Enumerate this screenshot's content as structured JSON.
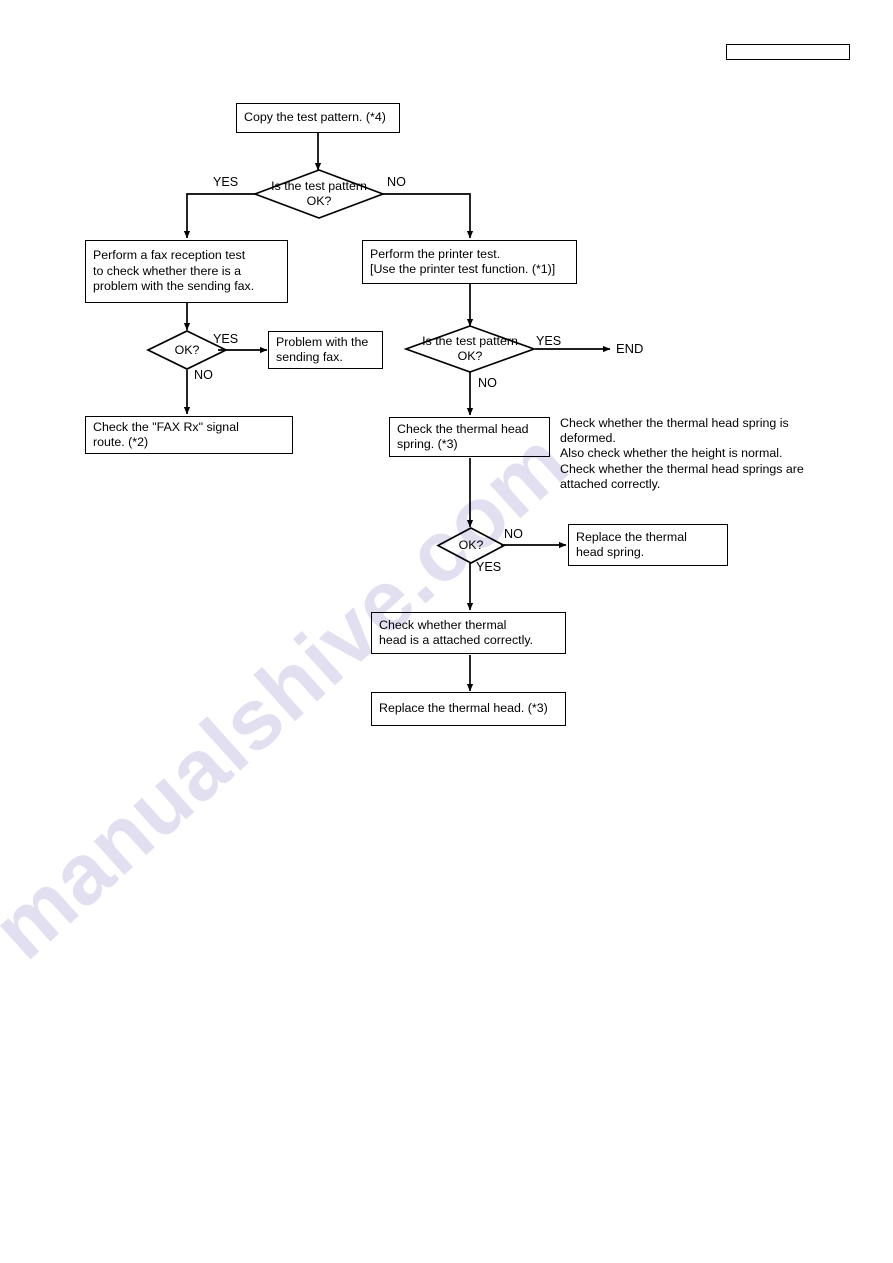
{
  "page": {
    "title": "Test pattern / thermal head troubleshooting flowchart",
    "background_color": "#ffffff",
    "line_color": "#000000"
  },
  "watermark": {
    "text": "manualshive.com",
    "color": "#4b3fa8"
  },
  "header": {
    "empty_box_label": ""
  },
  "nodes": {
    "copy_test_pattern": "Copy the test pattern. (*4)",
    "is_test_pattern_ok_1": "Is the test pattern\nOK?",
    "fax_reception_test": "Perform a fax reception test\nto check whether there is a\nproblem with the sending fax.",
    "printer_test": "Perform the printer test.\n[Use the printer test function. (*1)]",
    "ok_left": "OK?",
    "problem_sending_fax": "Problem with the\nsending fax.",
    "check_fax_rx_route": "Check the \"FAX Rx\" signal\nroute. (*2)",
    "is_test_pattern_ok_2": "Is the test pattern\nOK?",
    "end": "END",
    "check_thermal_head_spring": "Check the thermal head\nspring. (*3)",
    "spring_note": "Check whether the thermal head spring is\ndeformed.\nAlso check whether the height is normal.\nCheck whether the thermal head springs are\nattached correctly.",
    "ok_spring": "OK?",
    "replace_thermal_head_spring": "Replace the thermal\nhead spring.",
    "check_thermal_head_attached": "Check whether thermal\nhead is a attached correctly.",
    "replace_thermal_head": "Replace the thermal head. (*3)"
  },
  "edge_labels": {
    "yes_1": "YES",
    "no_1": "NO",
    "yes_left_ok": "YES",
    "no_left_ok": "NO",
    "yes_right_ok": "YES",
    "no_right_ok": "NO",
    "no_spring_ok": "NO",
    "yes_spring_ok": "YES"
  }
}
